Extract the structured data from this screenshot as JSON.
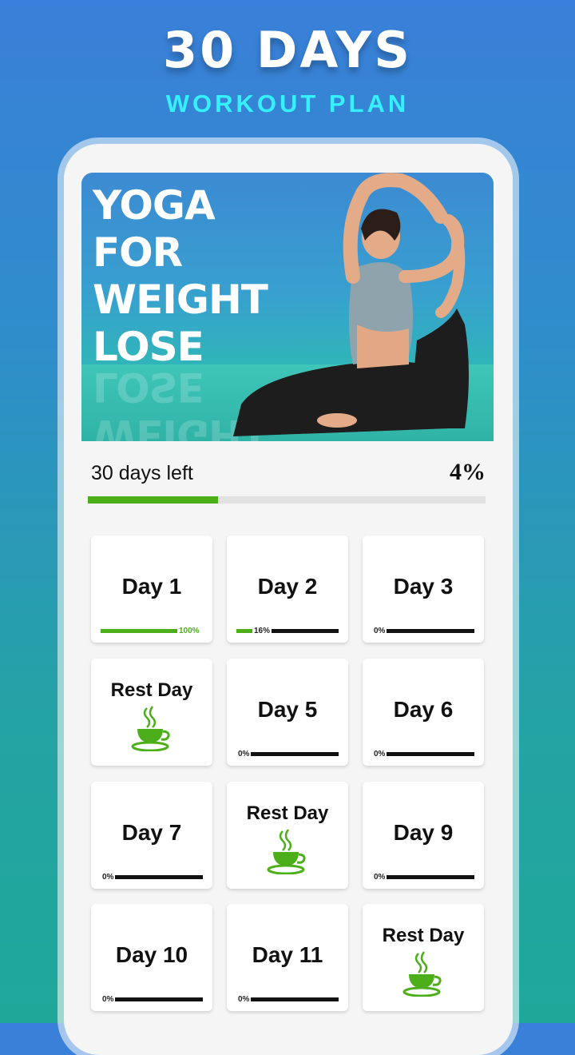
{
  "header": {
    "title": "30 DAYS",
    "subtitle": "WORKOUT PLAN"
  },
  "banner": {
    "line1": "YOGA",
    "line2": "FOR",
    "line3": "WEIGHT",
    "line4": "LOSE"
  },
  "progress": {
    "days_left": "30 days left",
    "percent_text": "4%",
    "percent": 4
  },
  "days": [
    {
      "label": "Day 1",
      "pct": "100%",
      "value": 100,
      "rest": false
    },
    {
      "label": "Day 2",
      "pct": "16%",
      "value": 16,
      "rest": false
    },
    {
      "label": "Day 3",
      "pct": "0%",
      "value": 0,
      "rest": false
    },
    {
      "label": "Rest Day",
      "rest": true
    },
    {
      "label": "Day 5",
      "pct": "0%",
      "value": 0,
      "rest": false
    },
    {
      "label": "Day 6",
      "pct": "0%",
      "value": 0,
      "rest": false
    },
    {
      "label": "Day 7",
      "pct": "0%",
      "value": 0,
      "rest": false
    },
    {
      "label": "Rest Day",
      "rest": true
    },
    {
      "label": "Day 9",
      "pct": "0%",
      "value": 0,
      "rest": false
    },
    {
      "label": "Day 10",
      "pct": "0%",
      "value": 0,
      "rest": false
    },
    {
      "label": "Day 11",
      "pct": "0%",
      "value": 0,
      "rest": false
    },
    {
      "label": "Rest Day",
      "rest": true
    }
  ],
  "colors": {
    "accent": "#4caf1a",
    "highlight": "#35f0ff"
  },
  "icons": {
    "rest": "coffee-cup-icon"
  }
}
